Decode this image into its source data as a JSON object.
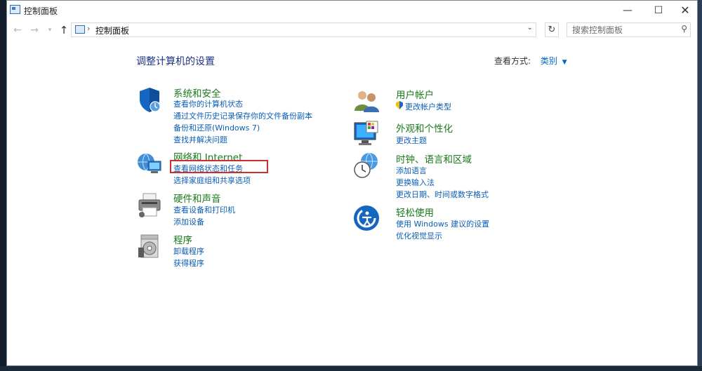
{
  "window": {
    "title": "控制面板"
  },
  "nav": {
    "address": "控制面板",
    "search_placeholder": "搜索控制面板"
  },
  "content": {
    "heading": "调整计算机的设置",
    "view_by_label": "查看方式:",
    "view_by_value": "类别"
  },
  "categories": {
    "system": {
      "title": "系统和安全",
      "links": [
        "查看你的计算机状态",
        "通过文件历史记录保存你的文件备份副本",
        "备份和还原(Windows 7)",
        "查找并解决问题"
      ]
    },
    "network": {
      "title": "网络和 Internet",
      "links": [
        "查看网络状态和任务",
        "选择家庭组和共享选项"
      ]
    },
    "hardware": {
      "title": "硬件和声音",
      "links": [
        "查看设备和打印机",
        "添加设备"
      ]
    },
    "programs": {
      "title": "程序",
      "links": [
        "卸载程序",
        "获得程序"
      ]
    },
    "user": {
      "title": "用户帐户",
      "links": [
        "更改帐户类型"
      ]
    },
    "appearance": {
      "title": "外观和个性化",
      "links": [
        "更改主题"
      ]
    },
    "clock": {
      "title": "时钟、语言和区域",
      "links": [
        "添加语言",
        "更换输入法",
        "更改日期、时间或数字格式"
      ]
    },
    "ease": {
      "title": "轻松使用",
      "links": [
        "使用 Windows 建议的设置",
        "优化视觉显示"
      ]
    }
  },
  "colors": {
    "category_title": "#1a7a1a",
    "link": "#0a5db5",
    "heading": "#1e3287",
    "highlight": "#cc2d2d"
  }
}
